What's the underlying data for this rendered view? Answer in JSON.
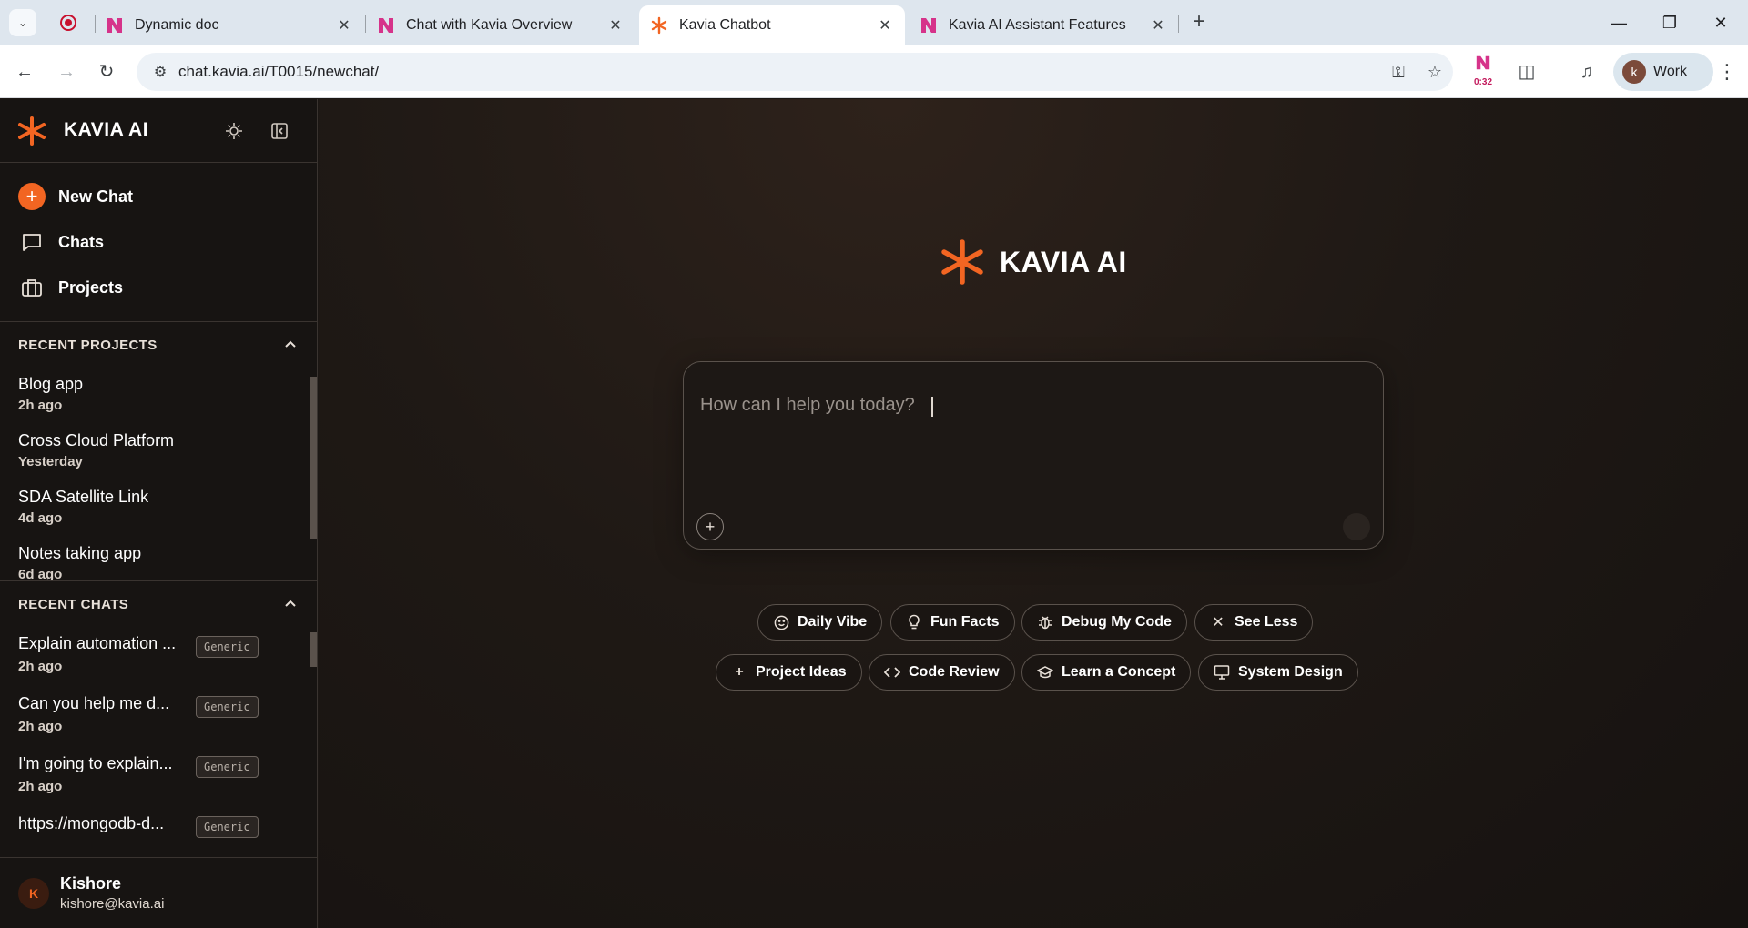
{
  "browser": {
    "tabs": [
      {
        "title": "Dynamic doc",
        "active": false
      },
      {
        "title": "Chat with Kavia Overview",
        "active": false
      },
      {
        "title": "Kavia Chatbot",
        "active": true
      },
      {
        "title": "Kavia AI Assistant Features",
        "active": false
      }
    ],
    "url": "chat.kavia.ai/T0015/newchat/",
    "recording_time": "0:32",
    "profile_initial": "k",
    "profile_label": "Work"
  },
  "brand": {
    "name": "KAVIA AI",
    "accent_color": "#f26522"
  },
  "sidebar": {
    "nav": [
      {
        "label": "New Chat",
        "icon": "plus-icon"
      },
      {
        "label": "Chats",
        "icon": "chat-bubble-icon"
      },
      {
        "label": "Projects",
        "icon": "briefcase-icon"
      }
    ],
    "recent_projects_title": "RECENT PROJECTS",
    "recent_projects": [
      {
        "name": "Blog app",
        "time": "2h ago"
      },
      {
        "name": "Cross Cloud Platform",
        "time": "Yesterday"
      },
      {
        "name": "SDA Satellite Link",
        "time": "4d ago"
      },
      {
        "name": "Notes taking app",
        "time": "6d ago"
      }
    ],
    "recent_chats_title": "RECENT CHATS",
    "recent_chats": [
      {
        "name": "Explain automation ...",
        "time": "2h ago",
        "badge": "Generic"
      },
      {
        "name": "Can you help me d...",
        "time": "2h ago",
        "badge": "Generic"
      },
      {
        "name": "I'm going to explain...",
        "time": "2h ago",
        "badge": "Generic"
      },
      {
        "name": "https://mongodb-d...",
        "time": "",
        "badge": "Generic"
      }
    ],
    "user": {
      "initial": "K",
      "name": "Kishore",
      "email": "kishore@kavia.ai"
    }
  },
  "main": {
    "title": "KAVIA AI",
    "prompt_placeholder": "How can I help you today?",
    "suggestions_row1": [
      {
        "label": "Daily Vibe",
        "icon": "smiley-icon"
      },
      {
        "label": "Fun Facts",
        "icon": "lightbulb-icon"
      },
      {
        "label": "Debug My Code",
        "icon": "bug-icon"
      },
      {
        "label": "See Less",
        "icon": "close-icon"
      }
    ],
    "suggestions_row2": [
      {
        "label": "Project Ideas",
        "icon": "plus-icon"
      },
      {
        "label": "Code Review",
        "icon": "code-icon"
      },
      {
        "label": "Learn a Concept",
        "icon": "graduation-cap-icon"
      },
      {
        "label": "System Design",
        "icon": "monitor-icon"
      }
    ]
  }
}
